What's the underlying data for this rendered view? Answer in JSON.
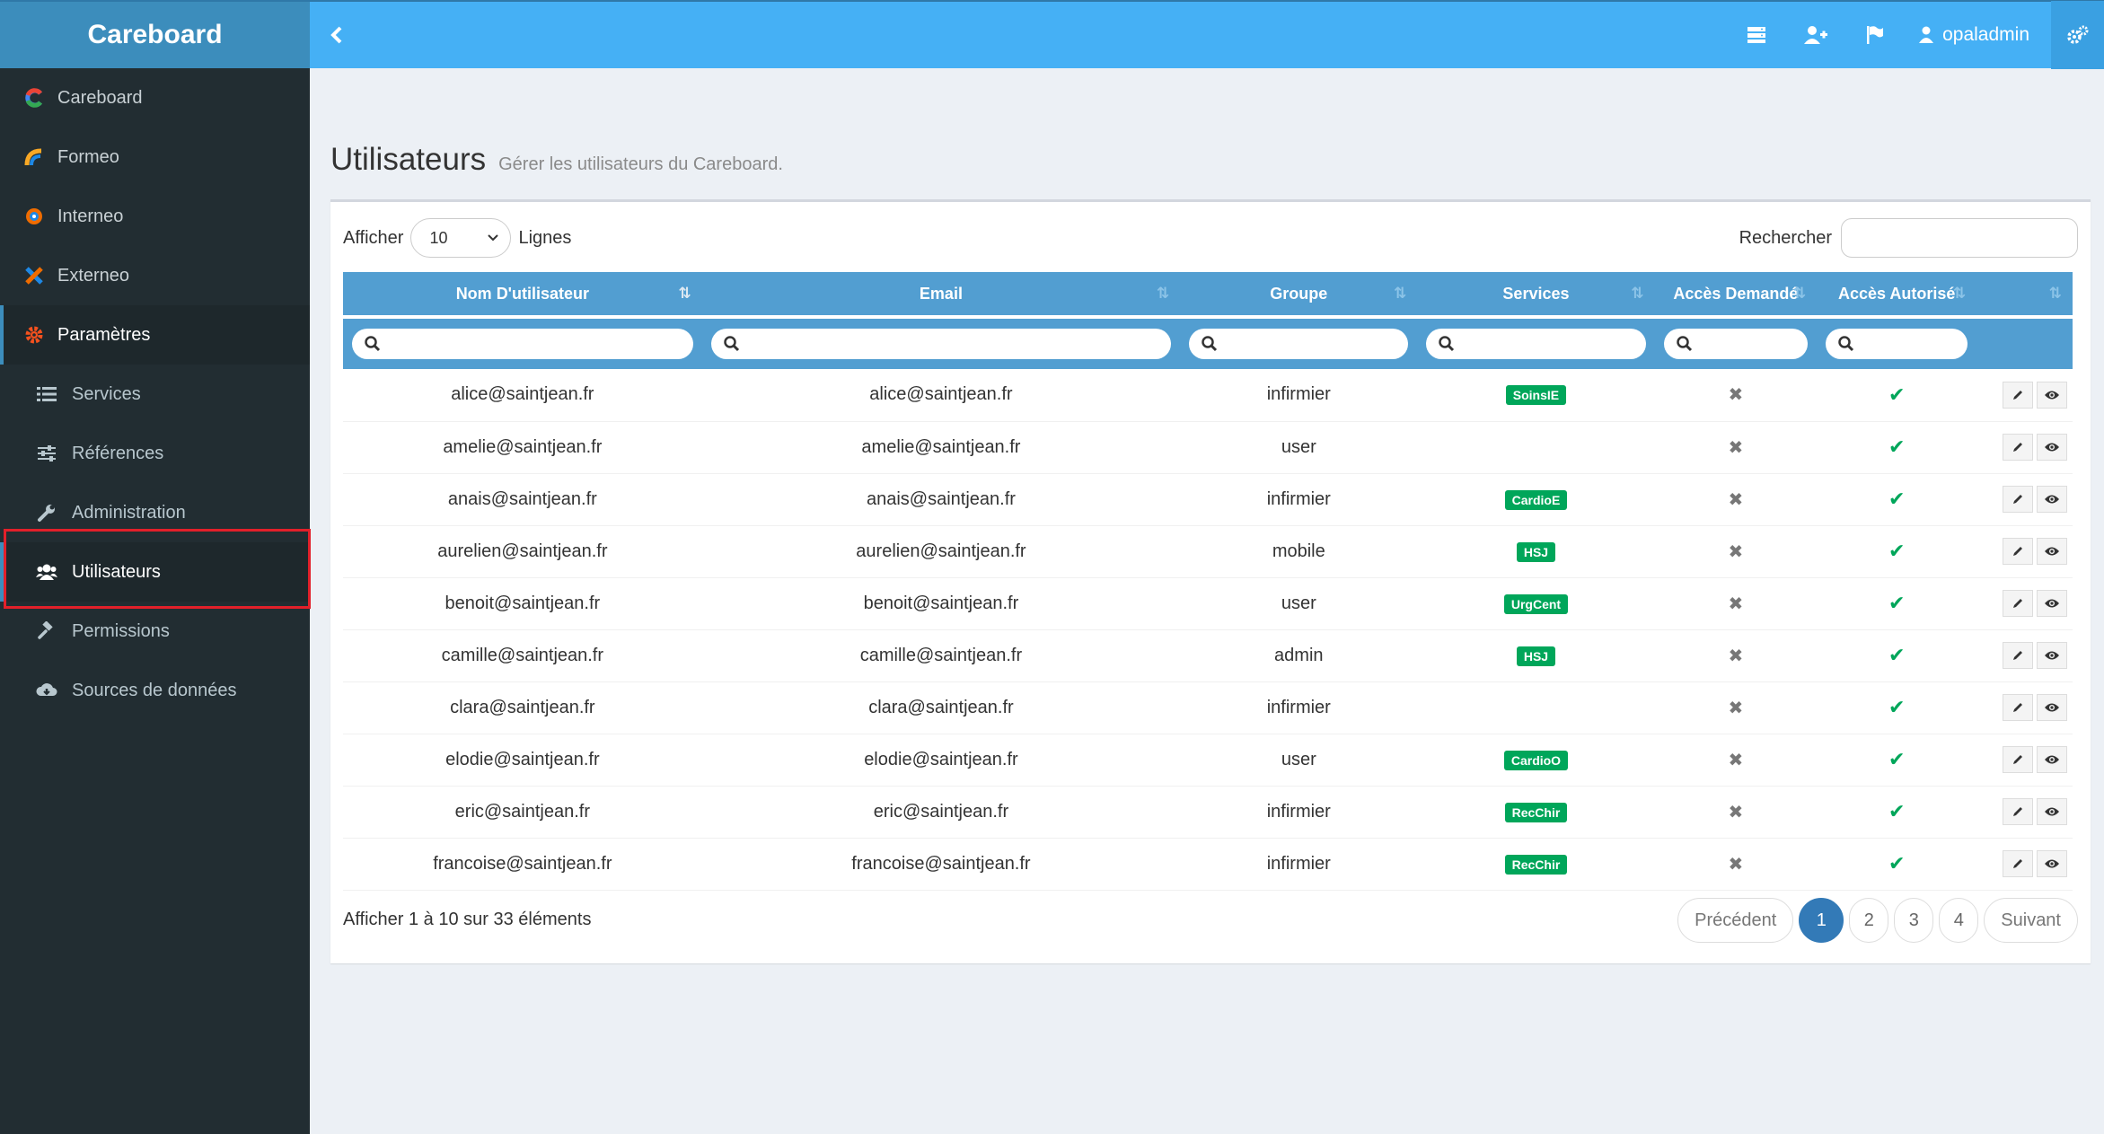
{
  "brand": "Careboard",
  "topbar": {
    "username": "opaladmin"
  },
  "sidebar": {
    "items": [
      {
        "label": "Careboard"
      },
      {
        "label": "Formeo"
      },
      {
        "label": "Interneo"
      },
      {
        "label": "Externeo"
      },
      {
        "label": "Paramètres"
      }
    ],
    "subitems": [
      {
        "label": "Services"
      },
      {
        "label": "Références"
      },
      {
        "label": "Administration"
      },
      {
        "label": "Utilisateurs"
      },
      {
        "label": "Permissions"
      },
      {
        "label": "Sources de données"
      }
    ]
  },
  "page": {
    "title": "Utilisateurs",
    "subtitle": "Gérer les utilisateurs du Careboard."
  },
  "controls": {
    "show_label": "Afficher",
    "length_value": "10",
    "lines_label": "Lignes",
    "search_label": "Rechercher"
  },
  "table": {
    "columns": [
      "Nom D'utilisateur",
      "Email",
      "Groupe",
      "Services",
      "Accès Demandé",
      "Accès Autorisé"
    ],
    "rows": [
      {
        "username": "alice@saintjean.fr",
        "email": "alice@saintjean.fr",
        "group": "infirmier",
        "service": "SoinsIE"
      },
      {
        "username": "amelie@saintjean.fr",
        "email": "amelie@saintjean.fr",
        "group": "user",
        "service": ""
      },
      {
        "username": "anais@saintjean.fr",
        "email": "anais@saintjean.fr",
        "group": "infirmier",
        "service": "CardioE"
      },
      {
        "username": "aurelien@saintjean.fr",
        "email": "aurelien@saintjean.fr",
        "group": "mobile",
        "service": "HSJ"
      },
      {
        "username": "benoit@saintjean.fr",
        "email": "benoit@saintjean.fr",
        "group": "user",
        "service": "UrgCent"
      },
      {
        "username": "camille@saintjean.fr",
        "email": "camille@saintjean.fr",
        "group": "admin",
        "service": "HSJ"
      },
      {
        "username": "clara@saintjean.fr",
        "email": "clara@saintjean.fr",
        "group": "infirmier",
        "service": ""
      },
      {
        "username": "elodie@saintjean.fr",
        "email": "elodie@saintjean.fr",
        "group": "user",
        "service": "CardioO"
      },
      {
        "username": "eric@saintjean.fr",
        "email": "eric@saintjean.fr",
        "group": "infirmier",
        "service": "RecChir"
      },
      {
        "username": "francoise@saintjean.fr",
        "email": "francoise@saintjean.fr",
        "group": "infirmier",
        "service": "RecChir"
      }
    ]
  },
  "footer": {
    "info": "Afficher 1 à 10 sur 33 éléments",
    "prev": "Précédent",
    "next": "Suivant",
    "pages": [
      "1",
      "2",
      "3",
      "4"
    ]
  }
}
